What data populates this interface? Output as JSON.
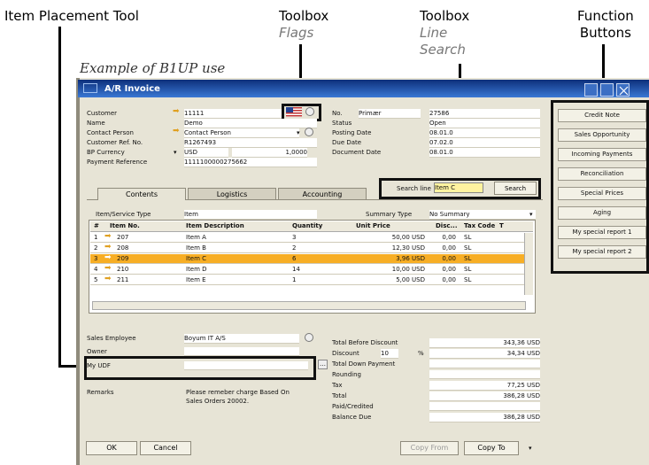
{
  "callouts": {
    "placement": "Item Placement Tool",
    "toolbox_flags_1": "Toolbox",
    "toolbox_flags_2": "Flags",
    "toolbox_search_1": "Toolbox",
    "toolbox_search_2": "Line",
    "toolbox_search_3": "Search",
    "function_1": "Function",
    "function_2": "Buttons",
    "example": "Example of B1UP use"
  },
  "window": {
    "title": "A/R Invoice"
  },
  "header_left": [
    {
      "label": "Customer",
      "value": "11111",
      "arrow": true
    },
    {
      "label": "Name",
      "value": "Demo",
      "arrow": false
    },
    {
      "label": "Contact Person",
      "value": "Contact Person",
      "arrow": true
    },
    {
      "label": "Customer Ref. No.",
      "value": "R1267493",
      "arrow": false
    },
    {
      "label": "BP Currency",
      "value": "USD",
      "extra": "1,0000",
      "arrow": false
    },
    {
      "label": "Payment Reference",
      "value": "1111100000275662",
      "arrow": false
    }
  ],
  "header_right": [
    {
      "label": "No.",
      "sub": "Primær",
      "value": "27586"
    },
    {
      "label": "Status",
      "value": "Open"
    },
    {
      "label": "Posting Date",
      "value": "08.01.0"
    },
    {
      "label": "Due Date",
      "value": "07.02.0"
    },
    {
      "label": "Document Date",
      "value": "08.01.0"
    }
  ],
  "tabs": [
    "Contents",
    "Logistics",
    "Accounting"
  ],
  "search": {
    "label": "Search line",
    "value": "Item C",
    "button": "Search"
  },
  "item_type": {
    "label": "Item/Service Type",
    "value": "Item"
  },
  "summary_type": {
    "label": "Summary Type",
    "value": "No Summary"
  },
  "grid": {
    "headers": [
      "#",
      "Item No.",
      "Item Description",
      "Quantity",
      "Unit Price",
      "Disc...",
      "Tax Code",
      "T"
    ],
    "rows": [
      {
        "n": "1",
        "item": "207",
        "desc": "Item A",
        "qty": "3",
        "price": "50,00 USD",
        "disc": "0,00",
        "tax": "SL"
      },
      {
        "n": "2",
        "item": "208",
        "desc": "Item B",
        "qty": "2",
        "price": "12,30 USD",
        "disc": "0,00",
        "tax": "SL"
      },
      {
        "n": "3",
        "item": "209",
        "desc": "Item C",
        "qty": "6",
        "price": "3,96 USD",
        "disc": "0,00",
        "tax": "SL"
      },
      {
        "n": "4",
        "item": "210",
        "desc": "Item D",
        "qty": "14",
        "price": "10,00 USD",
        "disc": "0,00",
        "tax": "SL"
      },
      {
        "n": "5",
        "item": "211",
        "desc": "Item E",
        "qty": "1",
        "price": "5,00 USD",
        "disc": "0,00",
        "tax": "SL"
      }
    ]
  },
  "footer_left": {
    "sales_emp_label": "Sales Employee",
    "sales_emp_value": "Boyum IT A/S",
    "owner_label": "Owner",
    "udf_label": "My UDF",
    "remarks_label": "Remarks",
    "remarks_value": "Please remeber charge Based On Sales Orders 20002."
  },
  "totals": [
    {
      "label": "Total Before Discount",
      "value": "343,36 USD"
    },
    {
      "label": "Discount",
      "pct": "10",
      "pct_sign": "%",
      "value": "34,34 USD"
    },
    {
      "label": "Total Down Payment",
      "value": ""
    },
    {
      "label": "Rounding",
      "value": ""
    },
    {
      "label": "Tax",
      "value": "77,25 USD"
    },
    {
      "label": "Total",
      "value": "386,28 USD"
    },
    {
      "label": "Paid/Credited",
      "value": ""
    },
    {
      "label": "Balance Due",
      "value": "386,28 USD"
    }
  ],
  "buttons": {
    "ok": "OK",
    "cancel": "Cancel",
    "copy_from": "Copy From",
    "copy_to": "Copy To"
  },
  "function_buttons": [
    "Credit Note",
    "Sales Opportunity",
    "Incoming Payments",
    "Reconciliation",
    "Special Prices",
    "Aging",
    "My special report 1",
    "My special report 2"
  ]
}
